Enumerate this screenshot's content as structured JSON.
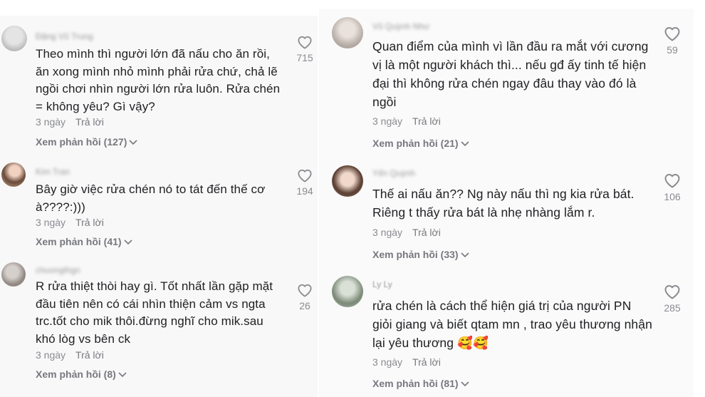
{
  "comments": [
    {
      "username": "Đặng Vũ Trung",
      "text": "Theo mình thì người lớn đã nấu cho ăn rồi, ăn xong mình nhỏ mình phải rửa chứ, chả lẽ ngồi chơi nhìn người lớn rửa luôn. Rửa chén = không yêu? Gì vậy?",
      "time": "3 ngày",
      "reply": "Trả lời",
      "view_replies": "Xem phản hồi (127)",
      "likes": "715"
    },
    {
      "username": "Kim Tran",
      "text": "Bây giờ việc rửa chén nó to tát đến thế cơ à????:)))",
      "time": "3 ngày",
      "reply": "Trả lời",
      "view_replies": "Xem phản hồi (41)",
      "likes": "194"
    },
    {
      "username": "chuongthgn",
      "text": "R rửa thiệt thòi hay gì. Tốt nhất lần gặp mặt đầu tiên nên có cái nhìn thiện cảm vs ngta trc.tốt cho mik thôi.đừng nghĩ cho mik.sau khó lòg vs bên ck",
      "time": "3 ngày",
      "reply": "Trả lời",
      "view_replies": "Xem phản hồi (8)",
      "likes": "26"
    },
    {
      "username": "Vũ Quỳnh Như",
      "text": "Quan điểm của mình vì lần đầu ra mắt với cương vị là một người khách thì... nếu gđ ấy tinh tế hiện đại thì không rửa chén ngay đâu thay vào đó là ngồi",
      "time": "3 ngày",
      "reply": "Trả lời",
      "view_replies": "Xem phản hồi (21)",
      "likes": "59"
    },
    {
      "username": "Yến Quỳnh",
      "text": "Thế ai nấu ăn?? Ng này nấu thì ng kia rửa bát. Riêng t thấy rửa bát là nhẹ nhàng lắm r.",
      "time": "3 ngày",
      "reply": "Trả lời",
      "view_replies": "Xem phản hồi (33)",
      "likes": "106"
    },
    {
      "username": "Ly Ly",
      "text": "rửa chén là cách thể hiện giá trị của người PN giỏi giang và biết qtam mn , trao yêu thương nhận lại yêu thương 🥰🥰",
      "time": "3 ngày",
      "reply": "Trả lời",
      "view_replies": "Xem phản hồi (81)",
      "likes": "285"
    }
  ],
  "colors": {
    "text": "#202124",
    "meta": "#8a8b91",
    "panel": "#f8f8f8"
  },
  "icons": {
    "like": "heart-outline-icon",
    "expand": "chevron-down-icon"
  }
}
